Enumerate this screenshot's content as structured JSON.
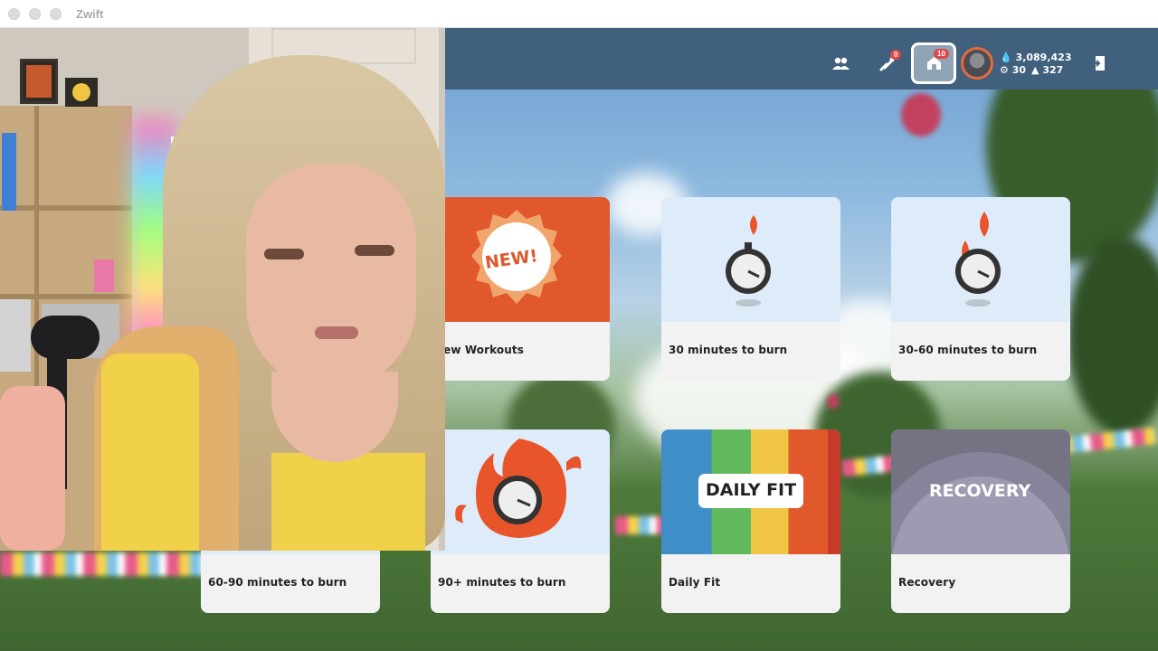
{
  "window": {
    "title": "Zwift"
  },
  "header": {
    "friends_icon": "friends-icon",
    "drops_badge": "0",
    "home_badge": "10",
    "stats": {
      "drops": "3,089,423",
      "level": "30",
      "distance": "327"
    }
  },
  "tiles": [
    {
      "label": "New Workouts",
      "art_text": "NEW!"
    },
    {
      "label": "30 minutes to burn"
    },
    {
      "label": "30-60 minutes to burn"
    },
    {
      "label": "60-90 minutes to burn"
    },
    {
      "label": "90+ minutes to burn"
    },
    {
      "label": "Daily Fit",
      "art_text": "DAILY FIT"
    },
    {
      "label": "Recovery",
      "art_text": "RECOVERY"
    }
  ],
  "colors": {
    "topbar": "#40607d",
    "accent_orange": "#e0582c",
    "tile_bg": "#f2f2f2",
    "tile_art_bg": "#deebf8",
    "badge_red": "#e04848"
  }
}
